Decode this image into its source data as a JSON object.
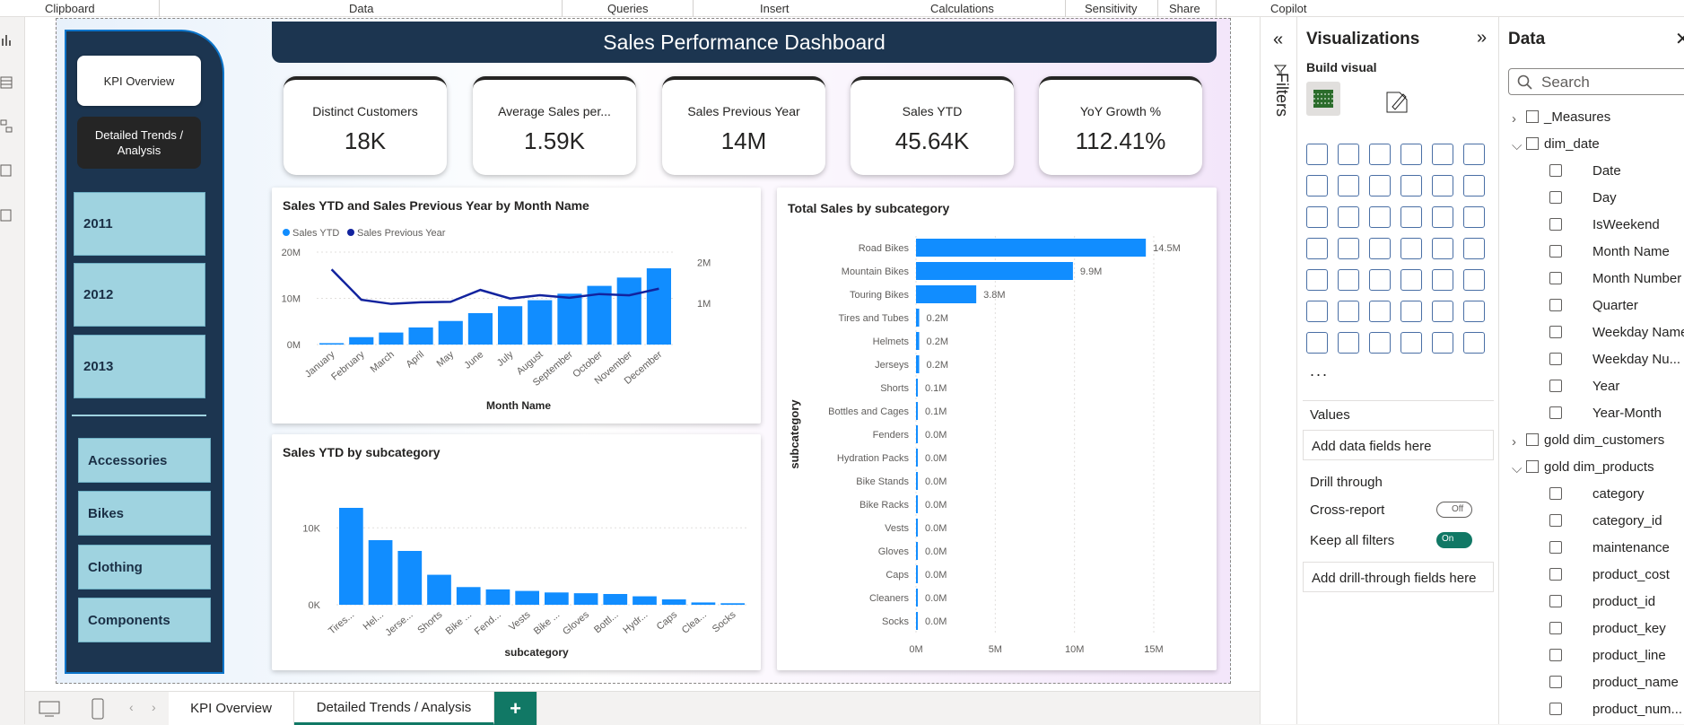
{
  "ribbon": {
    "groups": [
      "Clipboard",
      "Data",
      "Queries",
      "Insert",
      "Calculations",
      "Sensitivity",
      "Share",
      "Copilot"
    ]
  },
  "nav": {
    "kpi_button": "KPI Overview",
    "trend_button": "Detailed Trends / Analysis",
    "years": [
      "2011",
      "2012",
      "2013"
    ],
    "categories": [
      "Accessories",
      "Bikes",
      "Clothing",
      "Components"
    ]
  },
  "dashboard_title": "Sales Performance Dashboard",
  "kpis": [
    {
      "label": "Distinct Customers",
      "value": "18K"
    },
    {
      "label": "Average Sales per...",
      "value": "1.59K"
    },
    {
      "label": "Sales Previous Year",
      "value": "14M"
    },
    {
      "label": "Sales YTD",
      "value": "45.64K"
    },
    {
      "label": "YoY Growth %",
      "value": "112.41%"
    }
  ],
  "chart_data": [
    {
      "type": "bar",
      "title": "Sales YTD and Sales Previous Year by Month Name",
      "xlabel": "Month Name",
      "legend": [
        "Sales YTD",
        "Sales Previous Year"
      ],
      "categories": [
        "January",
        "February",
        "March",
        "April",
        "May",
        "June",
        "July",
        "August",
        "September",
        "October",
        "November",
        "December"
      ],
      "series": [
        {
          "name": "Sales YTD",
          "type": "bar",
          "axis": "left",
          "values": [
            0.3,
            1.6,
            2.6,
            3.7,
            5.1,
            6.8,
            8.3,
            9.6,
            11.0,
            12.7,
            14.5,
            16.5
          ]
        },
        {
          "name": "Sales Previous Year",
          "type": "line",
          "axis": "right",
          "values": [
            1.83,
            1.09,
            0.99,
            1.03,
            1.04,
            1.33,
            1.12,
            1.2,
            1.14,
            1.23,
            1.2,
            1.36
          ]
        }
      ],
      "y_left_ticks": [
        "20M",
        "10M",
        "0M"
      ],
      "y_left_range": [
        0,
        20
      ],
      "y_right_ticks": [
        "2M",
        "1M"
      ],
      "y_right_range": [
        0,
        2.25
      ],
      "colors": [
        "#118dff",
        "#12239e"
      ]
    },
    {
      "type": "bar",
      "title": "Sales YTD by subcategory",
      "xlabel": "subcategory",
      "categories": [
        "Tires...",
        "Hel...",
        "Jerse...",
        "Shorts",
        "Bike ...",
        "Fend...",
        "Vests",
        "Bike ...",
        "Gloves",
        "Bottl...",
        "Hydr...",
        "Caps",
        "Clea...",
        "Socks"
      ],
      "values": [
        12.6,
        8.4,
        7.0,
        3.9,
        2.3,
        2.0,
        1.8,
        1.6,
        1.5,
        1.4,
        1.1,
        0.7,
        0.3,
        0.2
      ],
      "y_ticks": [
        "10K",
        "0K"
      ],
      "y_range": [
        0,
        14
      ],
      "colors": [
        "#118dff"
      ]
    },
    {
      "type": "bar",
      "orientation": "horizontal",
      "title": "Total Sales by subcategory",
      "ylabel": "subcategory",
      "categories": [
        "Road Bikes",
        "Mountain Bikes",
        "Touring Bikes",
        "Tires and Tubes",
        "Helmets",
        "Jerseys",
        "Shorts",
        "Bottles and Cages",
        "Fenders",
        "Hydration Packs",
        "Bike Stands",
        "Bike Racks",
        "Vests",
        "Gloves",
        "Caps",
        "Cleaners",
        "Socks"
      ],
      "values": [
        14.5,
        9.9,
        3.8,
        0.2,
        0.2,
        0.2,
        0.1,
        0.1,
        0.0,
        0.0,
        0.0,
        0.0,
        0.0,
        0.0,
        0.0,
        0.0,
        0.0
      ],
      "labels": [
        "14.5M",
        "9.9M",
        "3.8M",
        "0.2M",
        "0.2M",
        "0.2M",
        "0.1M",
        "0.1M",
        "0.0M",
        "0.0M",
        "0.0M",
        "0.0M",
        "0.0M",
        "0.0M",
        "0.0M",
        "0.0M",
        "0.0M"
      ],
      "x_ticks": [
        "0M",
        "5M",
        "10M",
        "15M"
      ],
      "x_range": [
        0,
        15
      ],
      "colors": [
        "#118dff"
      ]
    }
  ],
  "filters_label": "Filters",
  "visualizations": {
    "title": "Visualizations",
    "build_visual": "Build visual",
    "values_label": "Values",
    "values_well": "Add data fields here",
    "drill_through": "Drill through",
    "cross_report": "Cross-report",
    "cross_report_state": "Off",
    "keep_filters": "Keep all filters",
    "keep_filters_state": "On",
    "drill_well": "Add drill-through fields here",
    "more": "..."
  },
  "data_pane": {
    "title": "Data",
    "search_placeholder": "Search",
    "tables": [
      {
        "name": "_Measures",
        "expanded": false
      },
      {
        "name": "dim_date",
        "expanded": true,
        "fields": [
          "Date",
          "Day",
          "IsWeekend",
          "Month Name",
          "Month Number",
          "Quarter",
          "Weekday Name",
          "Weekday Nu...",
          "Year",
          "Year-Month"
        ]
      },
      {
        "name": "gold dim_customers",
        "expanded": false
      },
      {
        "name": "gold dim_products",
        "expanded": true,
        "fields": [
          "category",
          "category_id",
          "maintenance",
          "product_cost",
          "product_id",
          "product_key",
          "product_line",
          "product_name",
          "product_num..."
        ]
      }
    ]
  },
  "page_tabs": [
    "KPI Overview",
    "Detailed Trends / Analysis"
  ],
  "add_page": "+"
}
